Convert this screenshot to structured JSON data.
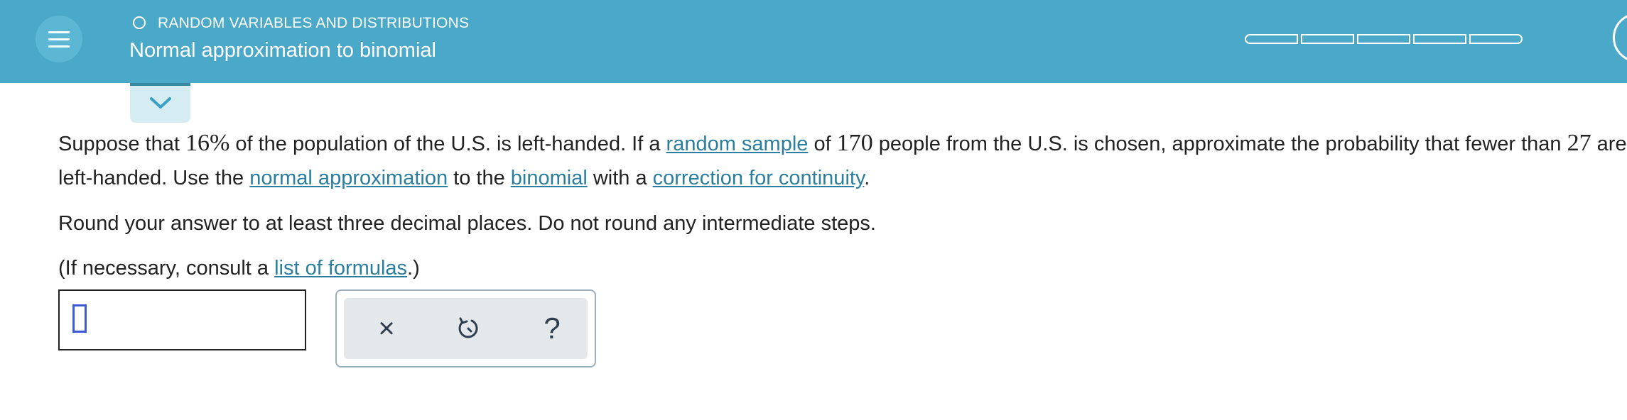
{
  "header": {
    "topic": "RANDOM VARIABLES AND DISTRIBUTIONS",
    "title": "Normal approximation to binomial",
    "progress_segments": 5
  },
  "question": {
    "t1": "Suppose that ",
    "n1": "16%",
    "t2": " of the population of the U.S. is left-handed. If a ",
    "link1": "random sample",
    "t3": " of ",
    "n2": "170",
    "t4": " people from the U.S. is chosen, approximate the probability that fewer than ",
    "n3": "27",
    "t5": " are left-handed. Use the ",
    "link2": "normal approximation",
    "t6": " to the ",
    "link3": "binomial",
    "t7": " with a ",
    "link4": "correction for continuity",
    "t8": "."
  },
  "instructions": {
    "round": "Round your answer to at least three decimal places. Do not round any intermediate steps.",
    "formula_pre": "(If necessary, consult a ",
    "formula_link": "list of formulas",
    "formula_post": ".)"
  },
  "answer": {
    "value": ""
  },
  "tools": {
    "clear": "×",
    "help": "?"
  },
  "colors": {
    "header_bg": "#4aa8c8",
    "link": "#2a7fa1"
  }
}
